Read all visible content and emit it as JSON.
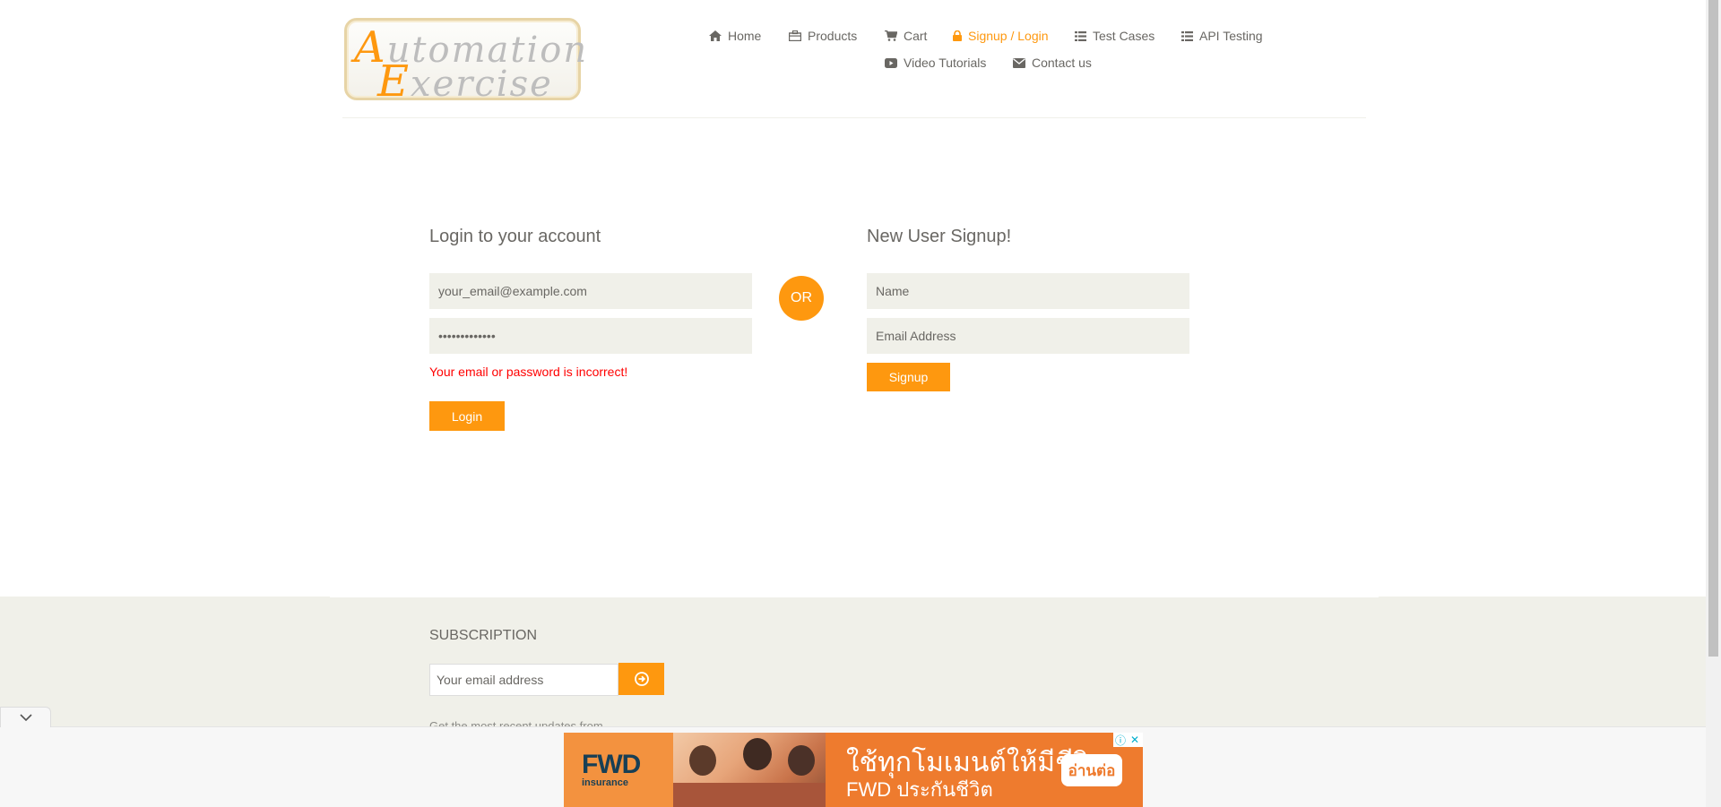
{
  "header": {
    "logo": {
      "line1_cap": "A",
      "line1_rest": "utomation",
      "line2_cap": "E",
      "line2_rest": "xercise"
    },
    "nav": [
      {
        "label": "Home",
        "icon": "home-icon",
        "active": false
      },
      {
        "label": "Products",
        "icon": "briefcase-icon",
        "active": false
      },
      {
        "label": "Cart",
        "icon": "cart-icon",
        "active": false
      },
      {
        "label": "Signup / Login",
        "icon": "lock-icon",
        "active": true
      },
      {
        "label": "Test Cases",
        "icon": "list-icon",
        "active": false
      },
      {
        "label": "API Testing",
        "icon": "list-icon",
        "active": false
      },
      {
        "label": "Video Tutorials",
        "icon": "youtube-icon",
        "active": false
      },
      {
        "label": "Contact us",
        "icon": "envelope-icon",
        "active": false
      }
    ]
  },
  "login": {
    "title": "Login to your account",
    "email_value": "your_email@example.com",
    "password_value": "•••••••••••••",
    "error": "Your email or password is incorrect!",
    "button": "Login"
  },
  "or_label": "OR",
  "signup": {
    "title": "New User Signup!",
    "name_placeholder": "Name",
    "email_placeholder": "Email Address",
    "button": "Signup"
  },
  "footer": {
    "subscription_title": "SUBSCRIPTION",
    "email_placeholder": "Your email address",
    "note": "Get the most recent updates from"
  },
  "ad": {
    "brand": "FWD",
    "brand_sub": "insurance",
    "headline": "ใช้ทุกโมเมนต์ให้มีชีวิต",
    "subline": "FWD ประกันชีวิต",
    "cta": "อ่านต่อ"
  },
  "colors": {
    "accent": "#fe980f",
    "text": "#696763",
    "error": "#ff0000",
    "field_bg": "#f0f0e9"
  }
}
